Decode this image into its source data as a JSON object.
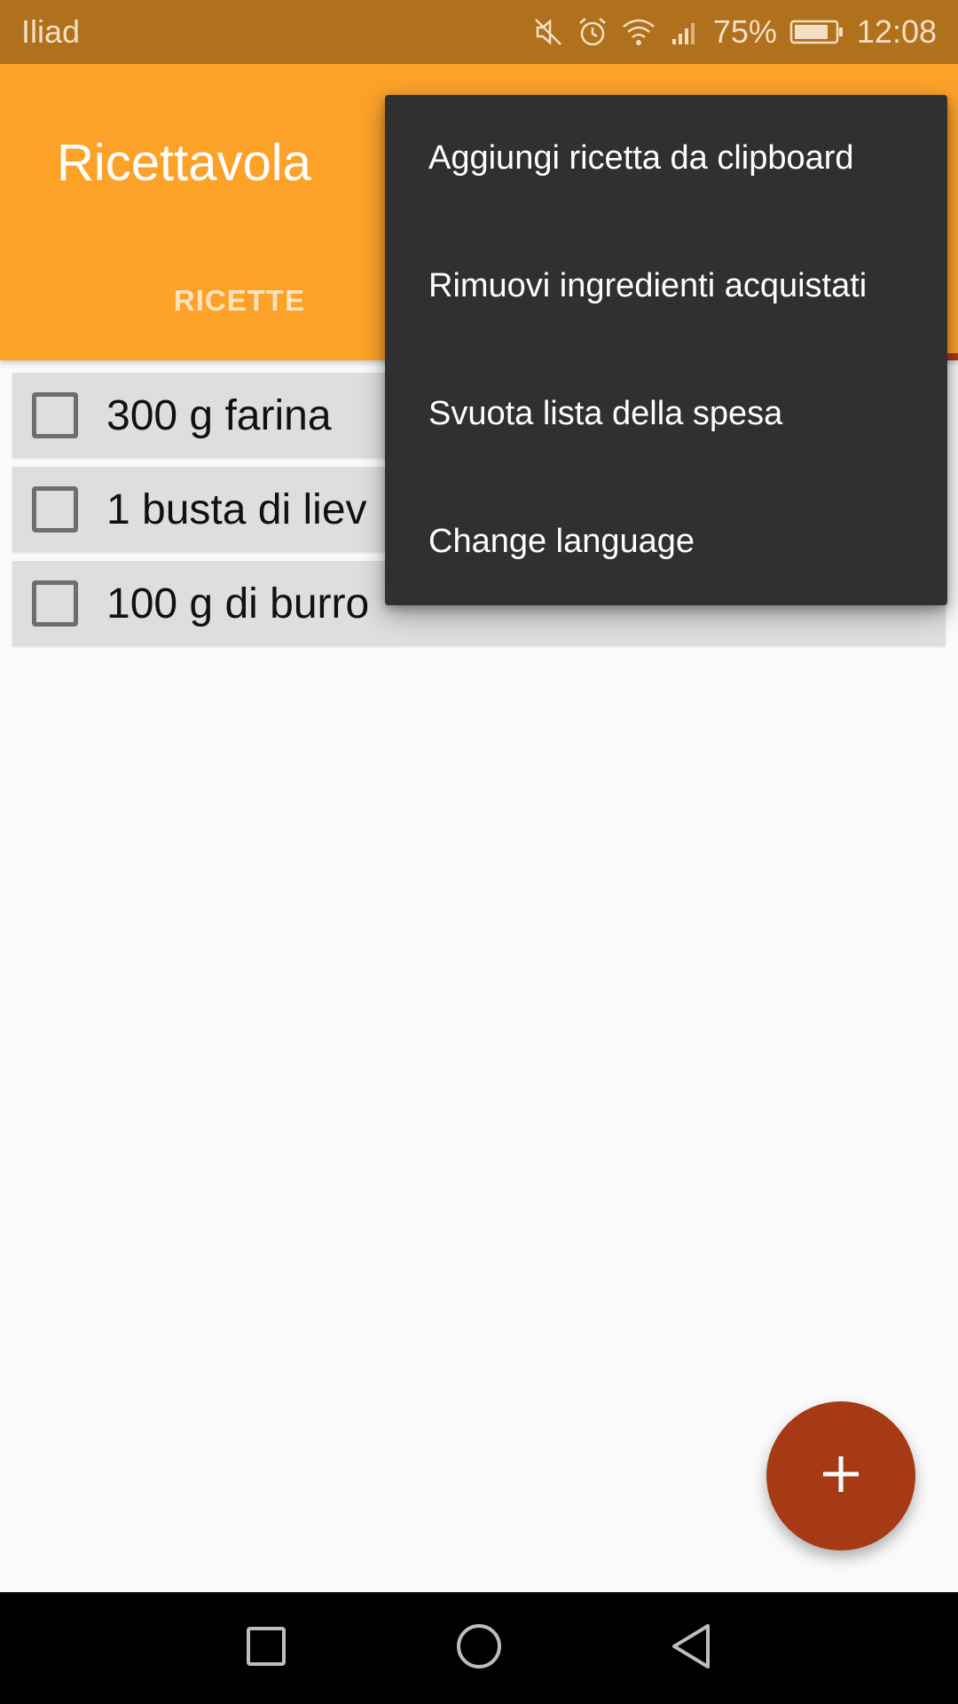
{
  "status_bar": {
    "carrier": "Iliad",
    "battery_percent": "75%",
    "time": "12:08",
    "icons": [
      "mute-icon",
      "alarm-icon",
      "wifi-icon",
      "signal-icon",
      "battery-icon"
    ]
  },
  "app_bar": {
    "title": "Ricettavola",
    "tabs": [
      {
        "label": "RICETTE",
        "selected": false
      },
      {
        "label": "",
        "selected": true
      }
    ]
  },
  "shopping_list": {
    "items": [
      {
        "text": "300 g farina",
        "checked": false
      },
      {
        "text": "1 busta di liev",
        "checked": false
      },
      {
        "text": "100 g di burro",
        "checked": false
      }
    ]
  },
  "overflow_menu": {
    "items": [
      {
        "label": "Aggiungi ricetta da clipboard"
      },
      {
        "label": "Rimuovi ingredienti acquistati"
      },
      {
        "label": "Svuota lista della spesa"
      },
      {
        "label": "Change language"
      }
    ]
  },
  "fab": {
    "icon": "plus-icon"
  },
  "nav_bar": {
    "icons": [
      "recents-icon",
      "home-icon",
      "back-icon"
    ]
  },
  "colors": {
    "status_bar": "#b0701c",
    "app_bar": "#fca229",
    "accent": "#a63a14",
    "menu_bg": "#303030",
    "list_item_bg": "#dedede"
  }
}
